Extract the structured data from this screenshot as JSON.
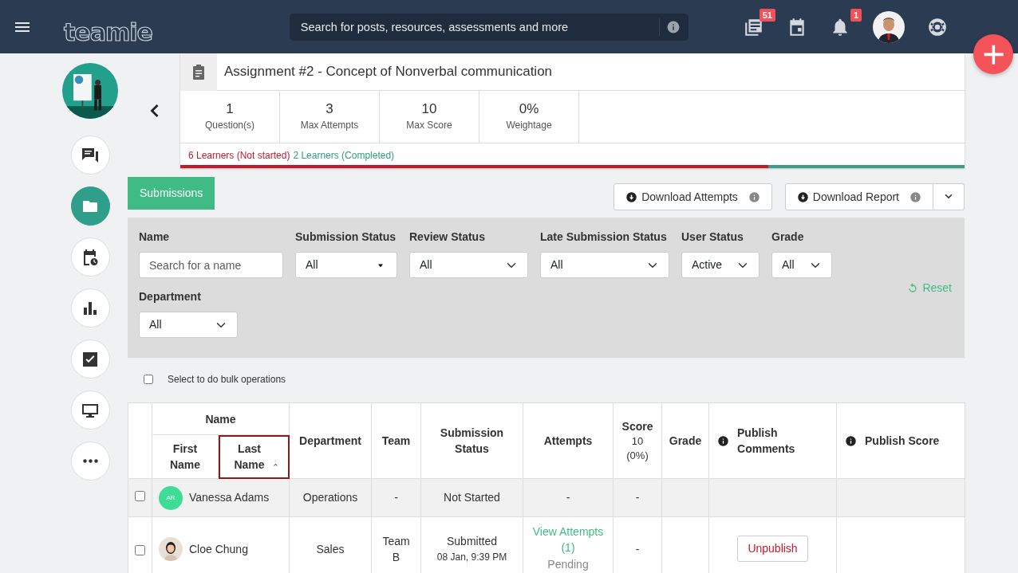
{
  "navbar": {
    "logo": "teamie",
    "search": {
      "placeholder": "Search for posts, resources, assessments and more"
    },
    "icons": [
      {
        "kind": "news",
        "badge": "51"
      },
      {
        "kind": "calendar"
      },
      {
        "kind": "bell",
        "badge": "1"
      },
      {
        "kind": "avatar"
      },
      {
        "kind": "help"
      }
    ]
  },
  "sidebar": {
    "items": [
      {
        "kind": "chat",
        "selected": false
      },
      {
        "kind": "folder",
        "selected": true
      },
      {
        "kind": "schedule",
        "selected": false
      },
      {
        "kind": "chart",
        "selected": false
      },
      {
        "kind": "check",
        "selected": false
      },
      {
        "kind": "monitor",
        "selected": false
      },
      {
        "kind": "more",
        "selected": false
      }
    ]
  },
  "assignment": {
    "title": "Assignment #2 - Concept of Nonverbal communication",
    "stats": [
      {
        "value": "1",
        "label": "Question(s)"
      },
      {
        "value": "3",
        "label": "Max Attempts"
      },
      {
        "value": "10",
        "label": "Max Score"
      },
      {
        "value": "0%",
        "label": "Weightage"
      }
    ],
    "not_started": "6 Learners (Not started)",
    "completed": "2 Learners (Completed)",
    "progress": {
      "level": 0.75
    }
  },
  "tab": {
    "label": "Submissions",
    "selected": true
  },
  "actions": [
    {
      "label": "Download Attempts",
      "split": false
    },
    {
      "label": "Download Report",
      "split": true
    }
  ],
  "filters": [
    {
      "label": "Name",
      "kind": "text",
      "placeholder": "Search for a name"
    },
    {
      "label": "Submission Status",
      "kind": "dropdown",
      "value": "All"
    },
    {
      "label": "Review Status",
      "kind": "select",
      "value": "All"
    },
    {
      "label": "Late Submission Status",
      "kind": "select",
      "value": "All"
    },
    {
      "label": "User Status",
      "kind": "select",
      "value": "Active"
    },
    {
      "label": "Grade",
      "kind": "select",
      "value": "All"
    },
    {
      "label": "Department",
      "kind": "select",
      "value": "All"
    }
  ],
  "reset": "Reset",
  "bulk": {
    "label": "Select to do bulk operations",
    "checked": false
  },
  "table": {
    "group": "Name",
    "columns": [
      {
        "label": "First Name",
        "sorted": false,
        "info": false
      },
      {
        "label": "Last Name",
        "sorted": true,
        "info": false
      },
      {
        "label": "Department",
        "sorted": false,
        "info": false
      },
      {
        "label": "Team",
        "sorted": false,
        "info": false
      },
      {
        "label": "Submission Status",
        "sorted": false,
        "info": false
      },
      {
        "label": "Attempts",
        "sorted": false,
        "info": false
      },
      {
        "label": "Score",
        "sub": [
          "10",
          "(0%)"
        ],
        "sorted": false,
        "info": false
      },
      {
        "label": "Grade",
        "sorted": false,
        "info": false
      },
      {
        "label": "Publish Comments",
        "sorted": false,
        "info": true
      },
      {
        "label": "Publish Score",
        "sorted": false,
        "info": true
      }
    ],
    "rows": [
      {
        "checked": false,
        "avatar": {
          "kind": "initials",
          "text": "AR",
          "color": "#3ddc97"
        },
        "name": "Vanessa Adams",
        "department": "Operations",
        "team": "-",
        "status": "Not Started",
        "attempts": "-",
        "score": "-",
        "shaded": true
      },
      {
        "checked": false,
        "name": "Cloe Chung",
        "department": "Sales",
        "team": "Team B",
        "status": "Submitted",
        "date": "08 Jan, 9:39 PM",
        "attempts_link": "View Attempts (1)",
        "attempts": "Pending",
        "score": "-",
        "publish_button": "Unpublish",
        "shaded": false
      }
    ]
  }
}
